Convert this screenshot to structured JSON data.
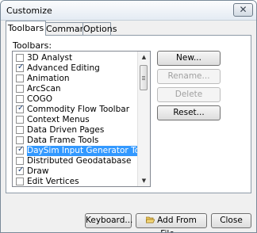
{
  "window": {
    "title": "Customize",
    "close_glyph": "✕"
  },
  "tabs": [
    {
      "label": "Toolbars"
    },
    {
      "label": "Commands"
    },
    {
      "label": "Options"
    }
  ],
  "toolbars_label": "Toolbars:",
  "toolbars": [
    {
      "label": "3D Analyst",
      "checked": false
    },
    {
      "label": "Advanced Editing",
      "checked": true
    },
    {
      "label": "Animation",
      "checked": false
    },
    {
      "label": "ArcScan",
      "checked": false
    },
    {
      "label": "COGO",
      "checked": false
    },
    {
      "label": "Commodity Flow Toolbar",
      "checked": true
    },
    {
      "label": "Context Menus",
      "checked": false
    },
    {
      "label": "Data Driven Pages",
      "checked": false
    },
    {
      "label": "Data Frame Tools",
      "checked": false
    },
    {
      "label": "DaySim Input Generator Toolbar",
      "checked": true,
      "selected": true
    },
    {
      "label": "Distributed Geodatabase",
      "checked": false
    },
    {
      "label": "Draw",
      "checked": true
    },
    {
      "label": "Edit Vertices",
      "checked": false
    }
  ],
  "buttons": {
    "new": "New...",
    "rename": "Rename...",
    "delete": "Delete",
    "reset": "Reset...",
    "keyboard": "Keyboard...",
    "add_from_file": "Add From File...",
    "close": "Close"
  },
  "icons": {
    "add_from_file": "folder-open-icon",
    "checkmark": "checkmark-icon"
  },
  "colors": {
    "selection": "#3399ff",
    "check": "#1c3f76"
  }
}
